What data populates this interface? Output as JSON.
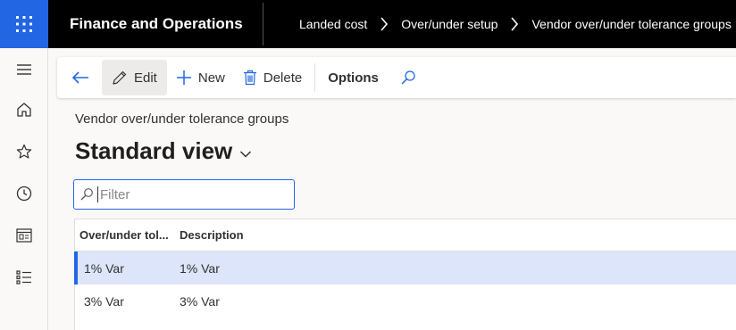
{
  "app": {
    "title": "Finance and Operations"
  },
  "breadcrumb": [
    "Landed cost",
    "Over/under setup",
    "Vendor over/under tolerance groups"
  ],
  "nav": {
    "items": [
      "menu-icon",
      "home-icon",
      "favorites-icon",
      "recent-icon",
      "workspaces-icon",
      "modules-icon"
    ]
  },
  "actions": {
    "edit": "Edit",
    "new": "New",
    "delete": "Delete",
    "options": "Options"
  },
  "page": {
    "caption": "Vendor over/under tolerance groups",
    "view": "Standard view"
  },
  "filter": {
    "placeholder": "Filter"
  },
  "grid": {
    "columns": [
      "Over/under tol...",
      "Description"
    ],
    "rows": [
      {
        "group": "1% Var",
        "description": "1% Var",
        "selected": true
      },
      {
        "group": "3% Var",
        "description": "3% Var",
        "selected": false
      }
    ]
  },
  "colors": {
    "accent": "#2266e3",
    "topbar": "#000000",
    "selected_row": "#dce5f9"
  }
}
